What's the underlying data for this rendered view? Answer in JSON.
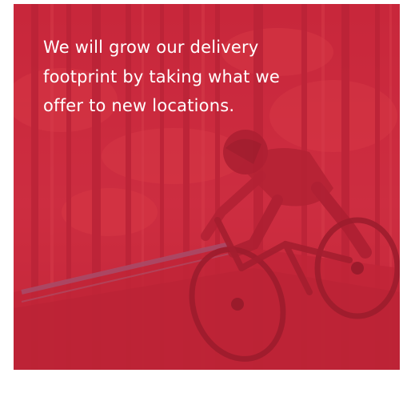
{
  "promo": {
    "headline": "We will grow our delivery footprint by taking what we offer to new locations.",
    "image": "mountain biker riding through forest",
    "overlay_color": "#c92c3a"
  }
}
